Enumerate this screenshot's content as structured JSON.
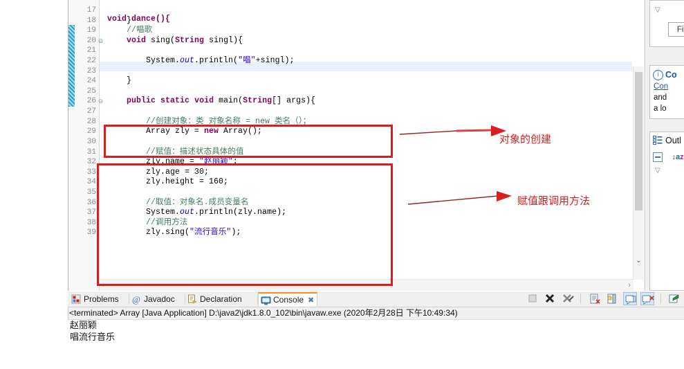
{
  "editor": {
    "first_visible_partial_line": "void dance(){",
    "highlighted_line": 22,
    "lines": [
      {
        "no": "17",
        "fold": "",
        "text": ""
      },
      {
        "no": "18",
        "fold": "",
        "text": "    }"
      },
      {
        "no": "19",
        "fold": "",
        "text": "    //唱歌"
      },
      {
        "no": "20",
        "fold": "-",
        "text": "    void sing(String singl){"
      },
      {
        "no": "21",
        "fold": "",
        "text": ""
      },
      {
        "no": "22",
        "fold": "",
        "text": "        System.out.println(\"唱\"+singl);"
      },
      {
        "no": "23",
        "fold": "",
        "text": ""
      },
      {
        "no": "24",
        "fold": "",
        "text": "    }"
      },
      {
        "no": "25",
        "fold": "",
        "text": ""
      },
      {
        "no": "26",
        "fold": "-",
        "text": "    public static void main(String[] args){"
      },
      {
        "no": "27",
        "fold": "",
        "text": ""
      },
      {
        "no": "28",
        "fold": "",
        "text": "        //创建对象：类 对象名称 = new 类名（）；"
      },
      {
        "no": "29",
        "fold": "",
        "text": "        Array zly = new Array();"
      },
      {
        "no": "30",
        "fold": "",
        "text": ""
      },
      {
        "no": "31",
        "fold": "",
        "text": "        //赋值：描述状态具体的值"
      },
      {
        "no": "32",
        "fold": "",
        "text": "        zly.name = \"赵丽颖\";"
      },
      {
        "no": "33",
        "fold": "",
        "text": "        zly.age = 30;"
      },
      {
        "no": "34",
        "fold": "",
        "text": "        zly.height = 160;"
      },
      {
        "no": "35",
        "fold": "",
        "text": ""
      },
      {
        "no": "36",
        "fold": "",
        "text": "        //取值：对象名.成员变量名"
      },
      {
        "no": "37",
        "fold": "",
        "text": "        System.out.println(zly.name);"
      },
      {
        "no": "38",
        "fold": "",
        "text": "        //调用方法"
      },
      {
        "no": "39",
        "fold": "",
        "text": "        zly.sing(\"流行音乐\");"
      }
    ],
    "hscroll_left": "‹",
    "hscroll_right": "›",
    "vscroll_down": "⌄"
  },
  "annotations": {
    "box1_label": "对象的创建",
    "box2_label": "赋值跟调用方法",
    "color": "#d81f1f"
  },
  "right_strip": {
    "find_caret": "▽",
    "find_button": "Find",
    "help_title": "Co",
    "help_line1": "Con",
    "help_line2": "and",
    "help_line3": "a lo",
    "outline_title": "Outl",
    "outline_sort_a": "a",
    "outline_sort_z": "z",
    "outline_caret": "▽"
  },
  "console": {
    "tabs": [
      {
        "label": "Problems",
        "icon": "problems-icon",
        "selected": false,
        "closable": false
      },
      {
        "label": "Javadoc",
        "icon": "javadoc-icon",
        "selected": false,
        "closable": false
      },
      {
        "label": "Declaration",
        "icon": "declaration-icon",
        "selected": false,
        "closable": false
      },
      {
        "label": "Console",
        "icon": "console-icon",
        "selected": true,
        "closable": true
      }
    ],
    "close_glyph": "✖",
    "terminated_line": "<terminated> Array [Java Application] D:\\java2\\jdk1.8.0_102\\bin\\javaw.exe (2020年2月28日 下午10:49:34)",
    "output": [
      "赵丽颖",
      "唱流行音乐"
    ],
    "toolbar": [
      {
        "name": "terminate-button",
        "glyph": "■",
        "active": false,
        "disabled": true
      },
      {
        "name": "terminate-all-button",
        "glyph": "✖",
        "active": false,
        "disabled": false
      },
      {
        "name": "remove-all-terminated-button",
        "glyph": "✖",
        "active": false,
        "disabled": false
      },
      {
        "name": "clear-console-button",
        "glyph": "▤",
        "active": false,
        "disabled": false
      },
      {
        "name": "scroll-lock-button",
        "glyph": "▥",
        "active": false,
        "disabled": false
      },
      {
        "name": "pin-console-button",
        "glyph": "▣",
        "active": true,
        "disabled": false
      },
      {
        "name": "display-selected-console-button",
        "glyph": "▣",
        "active": true,
        "disabled": false
      },
      {
        "name": "open-console-button",
        "glyph": "◪",
        "active": false,
        "disabled": false
      }
    ]
  }
}
